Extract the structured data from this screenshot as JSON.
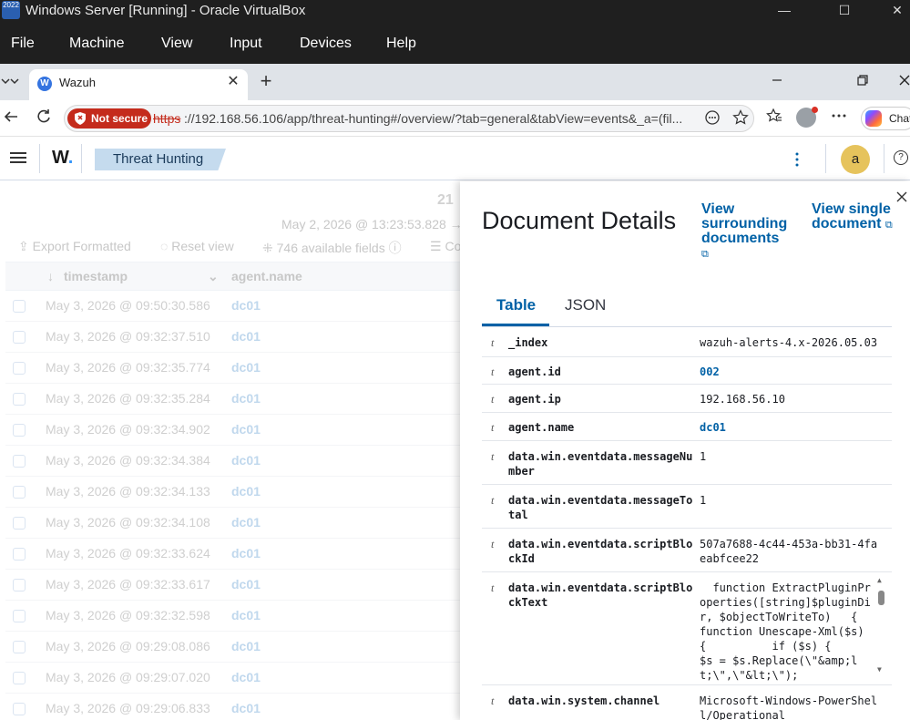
{
  "vbox": {
    "title": "Windows Server [Running] - Oracle VirtualBox",
    "logo_text": "2022",
    "minimize": "—",
    "maximize": "☐",
    "close": "✕",
    "menu": [
      "File",
      "Machine",
      "View",
      "Input",
      "Devices",
      "Help"
    ]
  },
  "browser": {
    "tab_title": "Wazuh",
    "tab_favicon": "W",
    "tab_close": "✕",
    "new_tab": "+",
    "not_secure": "Not secure",
    "url_protocol": "https",
    "url_rest": "://192.168.56.106/app/threat-hunting#/overview/?tab=general&tabView=events&_a=(fil...",
    "copilot_label": "Chat"
  },
  "header": {
    "logo_text": "W",
    "logo_dot": ".",
    "breadcrumb": "Threat Hunting",
    "avatar_letter": "a",
    "help": "?"
  },
  "discover": {
    "hits": "21",
    "date_range": "May 2, 2026 @ 13:23:53.828 →",
    "toolbar": {
      "export": "Export Formatted",
      "reset": "Reset view",
      "fields": "746 available fields",
      "columns": "Co"
    },
    "columns": [
      "timestamp",
      "agent.name"
    ],
    "rows": [
      {
        "ts": "May 3, 2026 @ 09:50:30.586",
        "agent": "dc01"
      },
      {
        "ts": "May 3, 2026 @ 09:32:37.510",
        "agent": "dc01"
      },
      {
        "ts": "May 3, 2026 @ 09:32:35.774",
        "agent": "dc01"
      },
      {
        "ts": "May 3, 2026 @ 09:32:35.284",
        "agent": "dc01"
      },
      {
        "ts": "May 3, 2026 @ 09:32:34.902",
        "agent": "dc01"
      },
      {
        "ts": "May 3, 2026 @ 09:32:34.384",
        "agent": "dc01"
      },
      {
        "ts": "May 3, 2026 @ 09:32:34.133",
        "agent": "dc01"
      },
      {
        "ts": "May 3, 2026 @ 09:32:34.108",
        "agent": "dc01"
      },
      {
        "ts": "May 3, 2026 @ 09:32:33.624",
        "agent": "dc01"
      },
      {
        "ts": "May 3, 2026 @ 09:32:33.617",
        "agent": "dc01"
      },
      {
        "ts": "May 3, 2026 @ 09:32:32.598",
        "agent": "dc01"
      },
      {
        "ts": "May 3, 2026 @ 09:29:08.086",
        "agent": "dc01"
      },
      {
        "ts": "May 3, 2026 @ 09:29:07.020",
        "agent": "dc01"
      },
      {
        "ts": "May 3, 2026 @ 09:29:06.833",
        "agent": "dc01"
      }
    ]
  },
  "flyout": {
    "title": "Document Details",
    "view_surrounding": "View surrounding documents",
    "view_single": "View single document",
    "tabs": [
      "Table",
      "JSON"
    ],
    "fields": [
      {
        "type": "t",
        "name": "_index",
        "value": "wazuh-alerts-4.x-2026.05.03",
        "link": false
      },
      {
        "type": "t",
        "name": "agent.id",
        "value": "002",
        "link": true
      },
      {
        "type": "t",
        "name": "agent.ip",
        "value": "192.168.56.10",
        "link": false
      },
      {
        "type": "t",
        "name": "agent.name",
        "value": "dc01",
        "link": true
      },
      {
        "type": "t",
        "name": "data.win.eventdata.messageNumber",
        "value": "1",
        "link": false
      },
      {
        "type": "t",
        "name": "data.win.eventdata.messageTotal",
        "value": "1",
        "link": false
      },
      {
        "type": "t",
        "name": "data.win.eventdata.scriptBlockId",
        "value": "507a7688-4c44-453a-bb31-4faeabfcee22",
        "link": false
      },
      {
        "type": "t",
        "name": "data.win.eventdata.scriptBlockText",
        "value": "  function ExtractPluginProperties([string]$pluginDir, $objectToWriteTo)   {   function Unescape-Xml($s)   {          if ($s) {     $s = $s.Replace(\\\"&amp;lt;\\\",\\\"&lt;\\\");",
        "link": false
      },
      {
        "type": "t",
        "name": "data.win.system.channel",
        "value": "Microsoft-Windows-PowerShell/Operational",
        "link": false
      }
    ]
  }
}
